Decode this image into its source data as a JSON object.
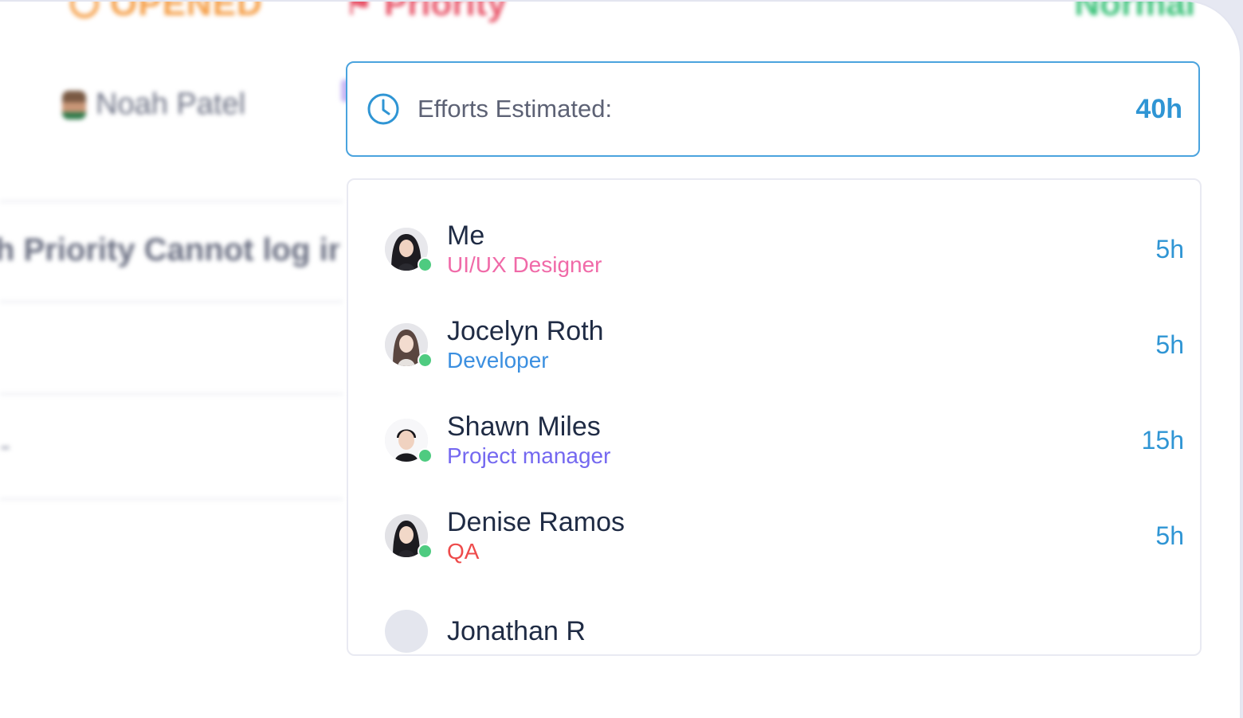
{
  "background": {
    "status": "OPENED",
    "priority": "Priority",
    "severity": "Normal",
    "assignee": "Noah Patel",
    "ticket_title": "h Priority Cannot log in",
    "placeholder_dash": "-"
  },
  "efforts": {
    "label": "Efforts Estimated:",
    "total": "40h",
    "icon": "clock-icon"
  },
  "members": [
    {
      "name": "Me",
      "role": "UI/UX Designer",
      "role_color": "#f06aa8",
      "hours": "5h",
      "status": "online"
    },
    {
      "name": "Jocelyn Roth",
      "role": "Developer",
      "role_color": "#3b8fe0",
      "hours": "5h",
      "status": "online"
    },
    {
      "name": "Shawn Miles",
      "role": "Project manager",
      "role_color": "#7468f0",
      "hours": "15h",
      "status": "online"
    },
    {
      "name": "Denise Ramos",
      "role": "QA",
      "role_color": "#ee4b4b",
      "hours": "5h",
      "status": "online"
    },
    {
      "name": "Jonathan R",
      "role": "",
      "role_color": "#1f2b44",
      "hours": "",
      "status": "online"
    }
  ],
  "colors": {
    "accent": "#2f95d4",
    "name_text": "#1f2b44",
    "online": "#4ecb80"
  }
}
